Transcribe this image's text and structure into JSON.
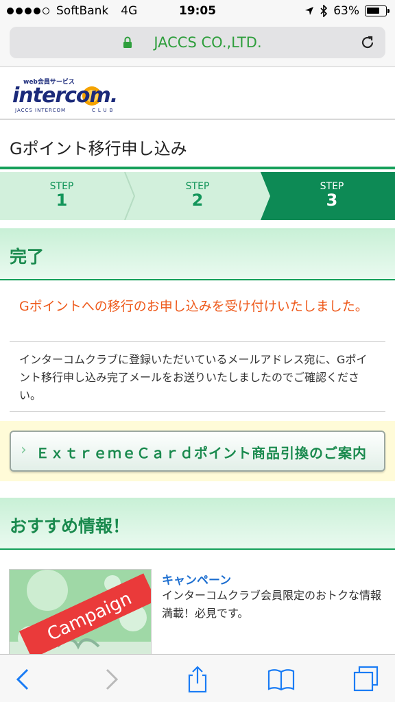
{
  "status_bar": {
    "carrier": "SoftBank",
    "network": "4G",
    "time": "19:05",
    "battery": "63%",
    "battery_level": 0.63,
    "signal_bars": 4
  },
  "url_bar": {
    "host": "JACCS CO.,LTD."
  },
  "logo": {
    "tagline": "web会員サービス",
    "name": "intercom",
    "sub": "JACCS INTERCOM CLUB"
  },
  "page": {
    "title": "Gポイント移行申し込み"
  },
  "steps": [
    {
      "label": "STEP",
      "number": "1"
    },
    {
      "label": "STEP",
      "number": "2"
    },
    {
      "label": "STEP",
      "number": "3"
    }
  ],
  "complete": {
    "heading": "完了",
    "message": "Gポイントへの移行のお申し込みを受け付けいたしました。",
    "body": "インターコムクラブに登録いただいているメールアドレス宛に、Gポイント移行申し込み完了メールをお送りいたしましたのでご確認ください。"
  },
  "card_button": {
    "label": "ＥｘｔｒｅｍｅＣａｒｄポイント商品引換のご案内"
  },
  "recommend": {
    "heading": "おすすめ情報！",
    "item": {
      "image_text": "Campaign",
      "title": "キャンペーン",
      "description": "インターコムクラブ会員限定のおトクな情報満載！必見です。"
    }
  },
  "colors": {
    "accent_green": "#15a05a",
    "orange_text": "#ee5a1c",
    "link_blue": "#1e6fd0"
  }
}
